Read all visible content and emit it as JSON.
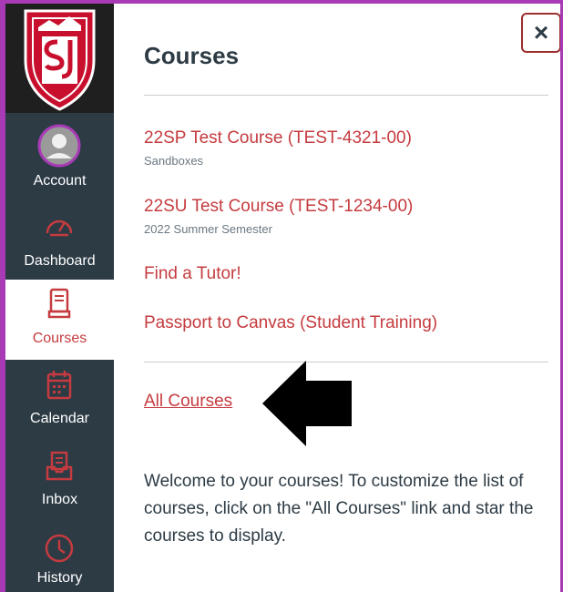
{
  "nav": {
    "items": [
      {
        "label": "Account"
      },
      {
        "label": "Dashboard"
      },
      {
        "label": "Courses"
      },
      {
        "label": "Calendar"
      },
      {
        "label": "Inbox"
      },
      {
        "label": "History"
      }
    ],
    "logo_letters": "S J",
    "active_color": "#c53b3f",
    "background_color": "#2d3b45"
  },
  "tray": {
    "title": "Courses",
    "close_symbol": "×",
    "courses": [
      {
        "name": "22SP Test Course (TEST-4321-00)",
        "term": "Sandboxes"
      },
      {
        "name": "22SU Test Course (TEST-1234-00)",
        "term": "2022 Summer Semester"
      }
    ],
    "links": [
      "Find a Tutor!",
      "Passport to Canvas (Student Training)"
    ],
    "all_courses_label": "All Courses",
    "welcome_text": "Welcome to your courses! To customize the list of courses, click on the \"All Courses\" link and star the courses to display."
  }
}
